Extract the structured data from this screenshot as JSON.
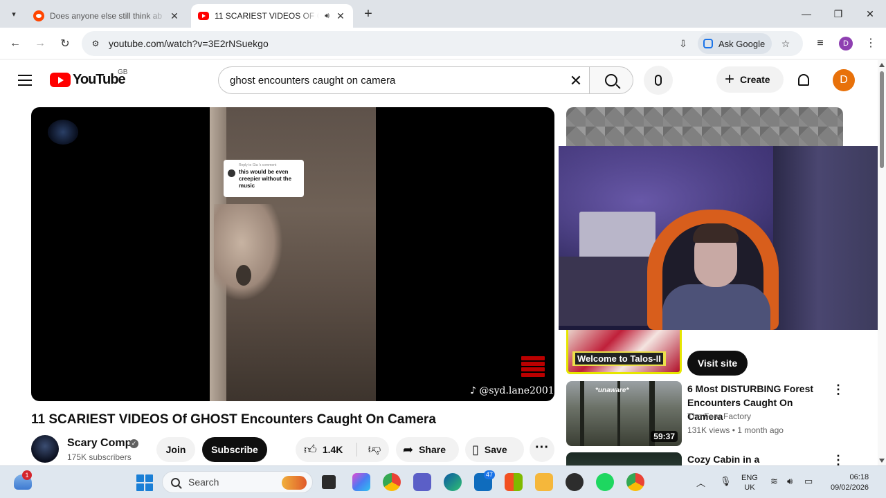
{
  "browser": {
    "tabs": [
      {
        "title": "Does anyone else still think ab",
        "active": false
      },
      {
        "title": "11 SCARIEST VIDEOS OF GH",
        "active": true
      }
    ],
    "url": "youtube.com/watch?v=3E2rNSuekgo",
    "ask_google": "Ask Google",
    "profile_initial": "D"
  },
  "youtube": {
    "logo_text": "YouTube",
    "country": "GB",
    "search_query": "ghost encounters caught on camera",
    "create_label": "Create",
    "avatar_initial": "D"
  },
  "video": {
    "overlay_reply_header": "Reply to Gia 's comment",
    "overlay_comment": "this would be even creepier without the music",
    "overlay_handle": "@syd.lane2001",
    "title": "11 SCARIEST VIDEOS Of GHOST Encounters Caught On Camera",
    "channel": "Scary Comp",
    "subscribers": "175K subscribers",
    "join_label": "Join",
    "subscribe_label": "Subscribe",
    "likes": "1.4K",
    "share_label": "Share",
    "save_label": "Save"
  },
  "sidebar": {
    "ad": {
      "image_text": "Welcome to Talos-II",
      "cta": "Visit site"
    },
    "recommendations": [
      {
        "title": "6 Most DISTURBING Forest Encounters Caught On Camera",
        "channel": "The Fear Factory",
        "meta": "131K views • 1 month ago",
        "duration": "59:37",
        "thumb_text": "*unaware*"
      },
      {
        "title": "Cozy Cabin in a Thunderstorm",
        "channel": "",
        "meta": "",
        "duration": ""
      }
    ]
  },
  "taskbar": {
    "weather_badge": "1",
    "search_label": "Search",
    "mail_badge": "47",
    "lang_line1": "ENG",
    "lang_line2": "UK",
    "time": "06:18",
    "date": "09/02/2026"
  }
}
